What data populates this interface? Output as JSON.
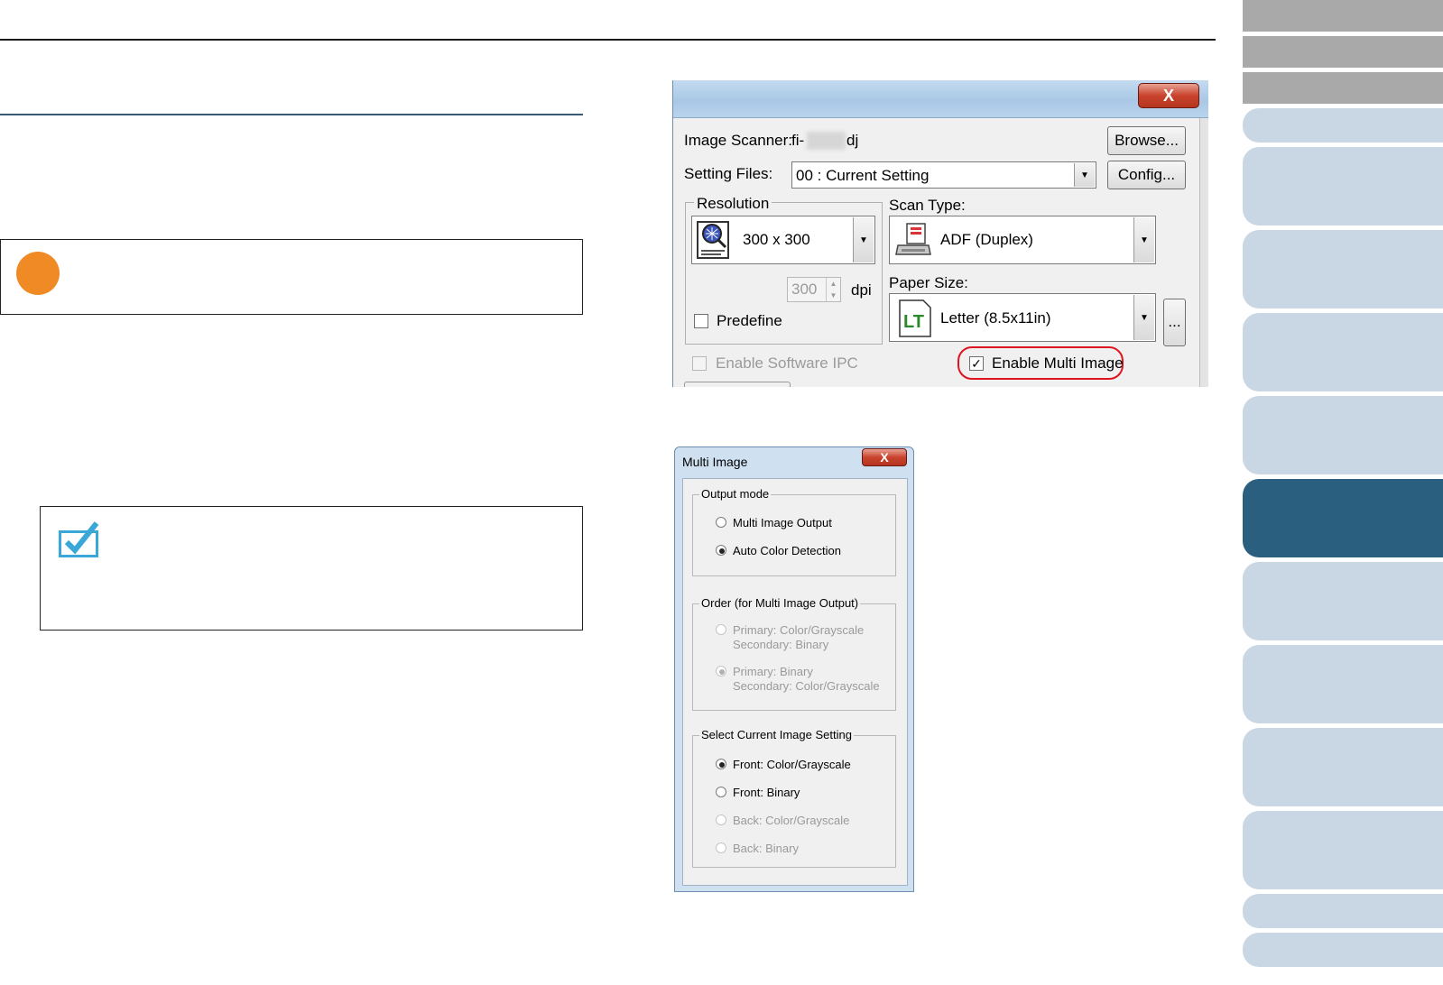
{
  "dialog_main": {
    "close_glyph": "X",
    "image_scanner_label": "Image Scanner:",
    "image_scanner_prefix": "fi-",
    "image_scanner_suffix": "dj",
    "browse_button": "Browse...",
    "setting_files_label": "Setting Files:",
    "setting_files_value": "00 : Current Setting",
    "config_button": "Config...",
    "resolution_group": "Resolution",
    "resolution_value": "300 x 300",
    "dpi_value": "300",
    "dpi_unit": "dpi",
    "predefine_label": "Predefine",
    "scan_type_label": "Scan Type:",
    "scan_type_value": "ADF (Duplex)",
    "paper_size_label": "Paper Size:",
    "paper_size_value": "Letter (8.5x11in)",
    "paper_more_button": "...",
    "enable_software_ipc": "Enable Software IPC",
    "enable_multi_image": "Enable Multi Image",
    "checked_glyph": "✓"
  },
  "dialog_multi": {
    "title": "Multi Image",
    "close_glyph": "X",
    "output_mode": {
      "legend": "Output mode",
      "options": [
        {
          "label": "Multi Image Output",
          "selected": false
        },
        {
          "label": "Auto Color Detection",
          "selected": true
        }
      ]
    },
    "order": {
      "legend": "Order (for Multi Image Output)",
      "options": [
        {
          "line1": "Primary: Color/Grayscale",
          "line2": "Secondary: Binary",
          "selected": false
        },
        {
          "line1": "Primary: Binary",
          "line2": "Secondary: Color/Grayscale",
          "selected": true
        }
      ]
    },
    "current_setting": {
      "legend": "Select Current Image Setting",
      "options": [
        {
          "label": "Front: Color/Grayscale",
          "selected": true
        },
        {
          "label": "Front: Binary",
          "selected": false
        },
        {
          "label": "Back: Color/Grayscale",
          "selected": false
        },
        {
          "label": "Back: Binary",
          "selected": false
        }
      ]
    }
  },
  "colors": {
    "accent_orange": "#f08a24",
    "active_tab": "#2a5f80",
    "tab": "#c8d7e3",
    "highlight_red": "#e0141e"
  }
}
